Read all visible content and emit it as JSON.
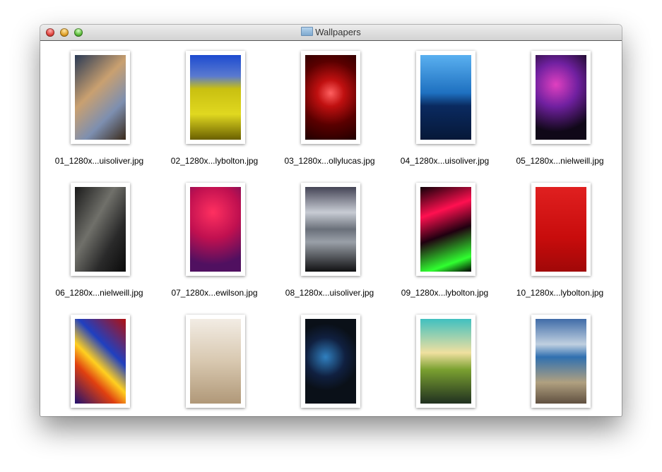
{
  "window": {
    "title": "Wallpapers"
  },
  "files": [
    {
      "name": "01_1280x...uisoliver.jpg",
      "bg": "linear-gradient(135deg,#2a3a55,#c9a070 40%,#7d8fb0 70%,#3a2a1a)"
    },
    {
      "name": "02_1280x...lybolton.jpg",
      "bg": "linear-gradient(#1d4bd0 0%,#5a7ad0 25%,#c9c010 40%,#e0d820 70%,#6a6000)"
    },
    {
      "name": "03_1280x...ollylucas.jpg",
      "bg": "radial-gradient(circle at 50% 45%,#ff6060,#c01010 25%,#5a0000 60%,#200000)"
    },
    {
      "name": "04_1280x...uisoliver.jpg",
      "bg": "linear-gradient(#5ab0f0,#1e70c0 45%,#0a2a60 60%,#061838)"
    },
    {
      "name": "05_1280x...nielweill.jpg",
      "bg": "radial-gradient(circle at 40% 35%,#e040c0,#7020a0 35%,#100818 75%)"
    },
    {
      "name": "06_1280x...nielweill.jpg",
      "bg": "linear-gradient(120deg,#1a1a1a,#70706a 40%,#2a2a2a 70%,#0a0a0a)"
    },
    {
      "name": "07_1280x...ewilson.jpg",
      "bg": "radial-gradient(circle at 45% 30%,#ff3060,#c01050 40%,#501060 80%)"
    },
    {
      "name": "08_1280x...uisoliver.jpg",
      "bg": "linear-gradient(#445,#c8ccd4 30%,#6a707a 50%,#9aa0a8 65%,#101012)"
    },
    {
      "name": "09_1280x...lybolton.jpg",
      "bg": "linear-gradient(160deg,#100008,#ff1050 30%,#200010 55%,#30ff30 85%,#000)"
    },
    {
      "name": "10_1280x...lybolton.jpg",
      "bg": "linear-gradient(#e02020,#c80c0c 60%,#a00808)"
    },
    {
      "name": "",
      "bg": "linear-gradient(45deg,#201070,#e04010 30%,#ffd020 45%,#2040c0 65%,#b01010)"
    },
    {
      "name": "",
      "bg": "linear-gradient(#f2ece4,#d8c8b0 50%,#b09878)"
    },
    {
      "name": "",
      "bg": "radial-gradient(circle at 40% 45%,#3080c0,#102040 35%,#0a1018 60%)"
    },
    {
      "name": "",
      "bg": "linear-gradient(#40c0c0,#f0e0a0 40%,#7aa030 60%,#203020)"
    },
    {
      "name": "",
      "bg": "linear-gradient(#406ca8,#c0d0e0 30%,#3070b0 45%,#b0a080 75%,#605040)"
    }
  ]
}
